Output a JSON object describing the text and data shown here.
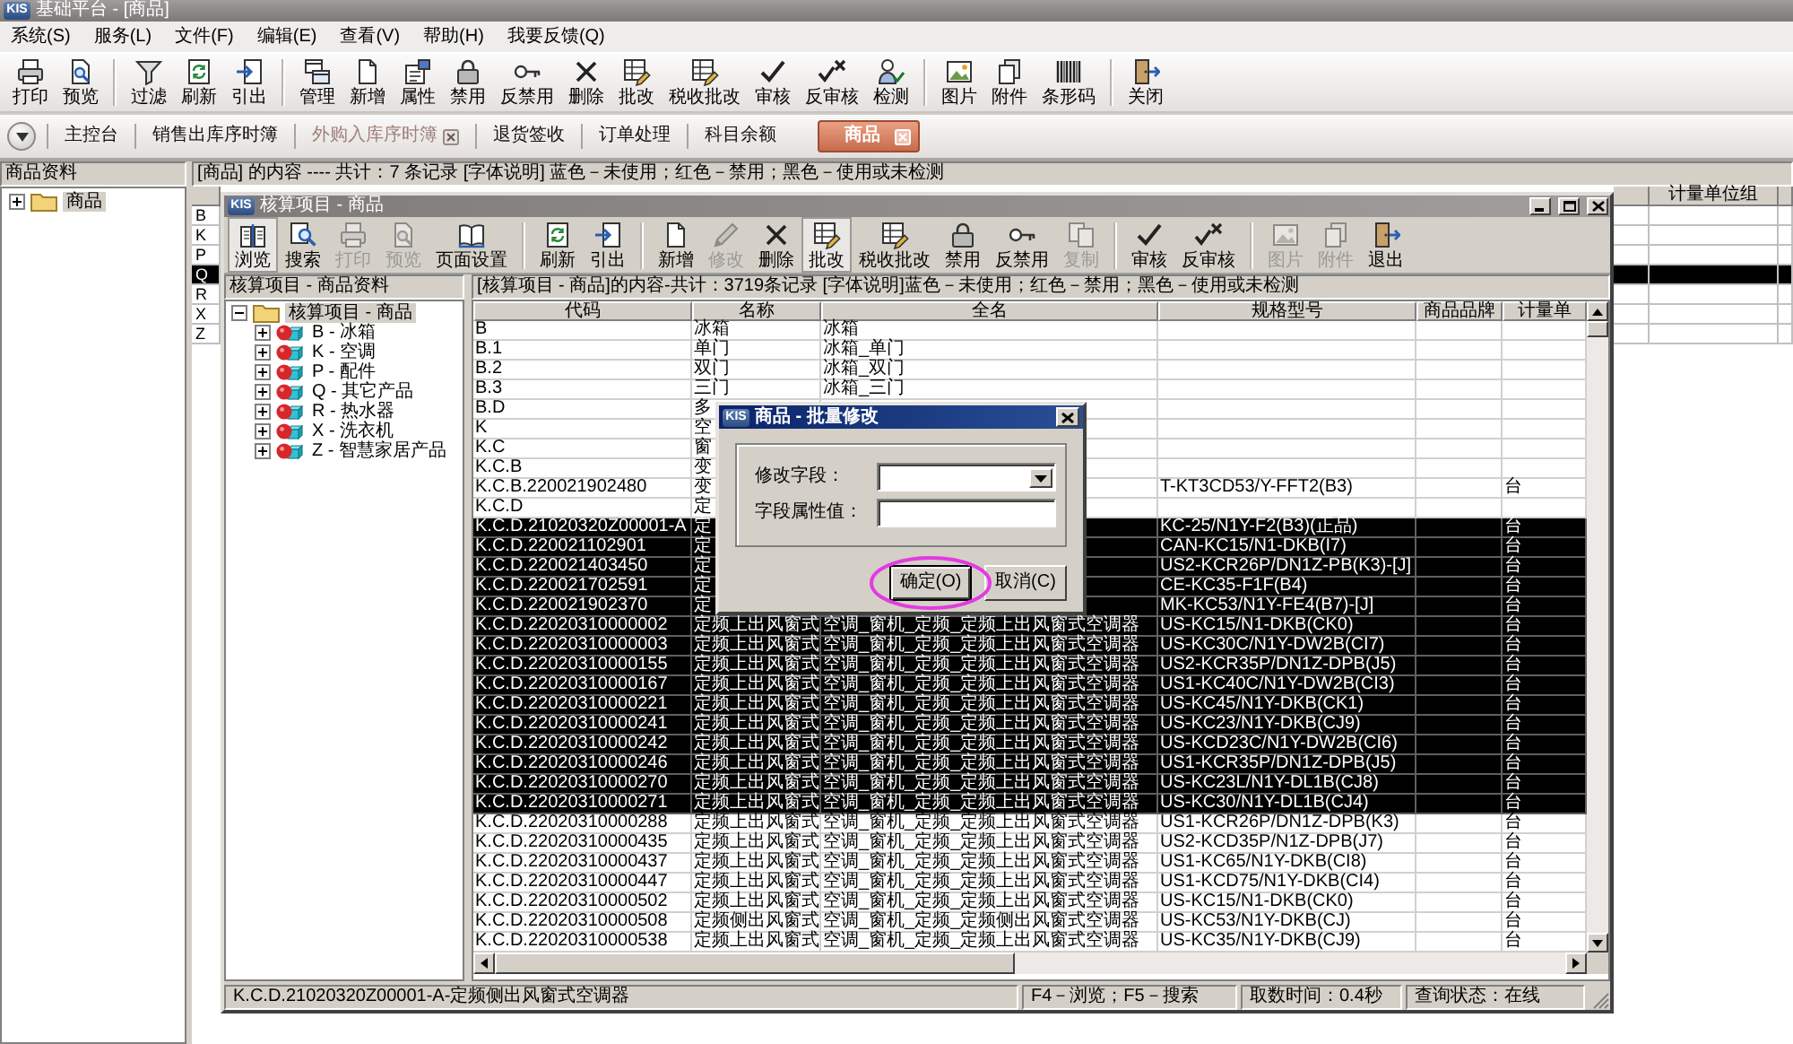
{
  "window": {
    "logo": "KIS",
    "title": "基础平台 - [商品]"
  },
  "menu": [
    "系统(S)",
    "服务(L)",
    "文件(F)",
    "编辑(E)",
    "查看(V)",
    "帮助(H)",
    "我要反馈(Q)"
  ],
  "toolbar": [
    [
      {
        "label": "打印"
      },
      {
        "label": "预览"
      }
    ],
    [
      {
        "label": "过滤"
      },
      {
        "label": "刷新"
      },
      {
        "label": "引出"
      }
    ],
    [
      {
        "label": "管理"
      },
      {
        "label": "新增"
      },
      {
        "label": "属性"
      },
      {
        "label": "禁用"
      },
      {
        "label": "反禁用"
      },
      {
        "label": "删除"
      },
      {
        "label": "批改"
      },
      {
        "label": "税收批改"
      },
      {
        "label": "审核"
      },
      {
        "label": "反审核"
      },
      {
        "label": "检测"
      }
    ],
    [
      {
        "label": "图片"
      },
      {
        "label": "附件"
      },
      {
        "label": "条形码"
      }
    ],
    [
      {
        "label": "关闭"
      }
    ]
  ],
  "tabs": [
    {
      "label": "主控台",
      "selected": false,
      "hovered": false
    },
    {
      "label": "销售出库序时簿",
      "selected": false,
      "hovered": false
    },
    {
      "label": "外购入库序时簿",
      "selected": false,
      "hovered": true
    },
    {
      "label": "退货签收",
      "selected": false,
      "hovered": false
    },
    {
      "label": "订单处理",
      "selected": false,
      "hovered": false
    },
    {
      "label": "科目余额",
      "selected": false,
      "hovered": false
    },
    {
      "label": "商品",
      "selected": true,
      "hovered": false
    }
  ],
  "left_panel": {
    "title": "商品资料",
    "tree": [
      {
        "label": "商品",
        "expanded": false,
        "selected": true
      }
    ]
  },
  "content_info": "[商品] 的内容 ---- 共计：7 条记录 [字体说明] 蓝色－未使用；红色－禁用；黑色－使用或未检测",
  "background_grid": {
    "columns": [
      "计量单位组"
    ],
    "rows": [
      {
        "code": "B",
        "selected": false
      },
      {
        "code": "K",
        "selected": false
      },
      {
        "code": "P",
        "selected": false
      },
      {
        "code": "Q",
        "selected": true
      },
      {
        "code": "R",
        "selected": false
      },
      {
        "code": "X",
        "selected": false
      },
      {
        "code": "Z",
        "selected": false
      }
    ]
  },
  "child_window": {
    "logo": "KIS",
    "title": "核算项目 - 商品",
    "toolbar": [
      [
        {
          "label": "浏览",
          "disabled": false,
          "pressed": true
        },
        {
          "label": "搜索",
          "disabled": false,
          "pressed": false
        },
        {
          "label": "打印",
          "disabled": true,
          "pressed": false
        },
        {
          "label": "预览",
          "disabled": true,
          "pressed": false
        },
        {
          "label": "页面设置",
          "disabled": false,
          "pressed": false
        }
      ],
      [
        {
          "label": "刷新",
          "disabled": false,
          "pressed": false
        },
        {
          "label": "引出",
          "disabled": false,
          "pressed": false
        }
      ],
      [
        {
          "label": "新增",
          "disabled": false,
          "pressed": false
        },
        {
          "label": "修改",
          "disabled": true,
          "pressed": false
        },
        {
          "label": "删除",
          "disabled": false,
          "pressed": false
        },
        {
          "label": "批改",
          "disabled": false,
          "pressed": true
        },
        {
          "label": "税收批改",
          "disabled": false,
          "pressed": false
        },
        {
          "label": "禁用",
          "disabled": false,
          "pressed": false
        },
        {
          "label": "反禁用",
          "disabled": false,
          "pressed": false
        },
        {
          "label": "复制",
          "disabled": true,
          "pressed": false
        }
      ],
      [
        {
          "label": "审核",
          "disabled": false,
          "pressed": false
        },
        {
          "label": "反审核",
          "disabled": false,
          "pressed": false
        }
      ],
      [
        {
          "label": "图片",
          "disabled": true,
          "pressed": false
        },
        {
          "label": "附件",
          "disabled": true,
          "pressed": false
        },
        {
          "label": "退出",
          "disabled": false,
          "pressed": false
        }
      ]
    ],
    "tree_title": "核算项目 - 商品资料",
    "info": "[核算项目 - 商品]的内容-共计：3719条记录 [字体说明]蓝色－未使用；红色－禁用；黑色－使用或未检测",
    "tree": [
      {
        "label": "核算项目 - 商品",
        "expanded": true,
        "selected": true,
        "children": [
          {
            "label": "B - 冰箱",
            "expanded": false,
            "selected": false
          },
          {
            "label": "K - 空调",
            "expanded": false,
            "selected": false
          },
          {
            "label": "P - 配件",
            "expanded": false,
            "selected": false
          },
          {
            "label": "Q - 其它产品",
            "expanded": false,
            "selected": false
          },
          {
            "label": "R - 热水器",
            "expanded": false,
            "selected": false
          },
          {
            "label": "X - 洗衣机",
            "expanded": false,
            "selected": false
          },
          {
            "label": "Z - 智慧家居产品",
            "expanded": false,
            "selected": false
          }
        ]
      }
    ],
    "table": {
      "columns": [
        "代码",
        "名称",
        "全名",
        "规格型号",
        "商品品牌",
        "计量单"
      ],
      "rows": [
        {
          "code": "B",
          "name": "冰箱",
          "full_name": "冰箱",
          "selected": false
        },
        {
          "code": "B.1",
          "name": "单门",
          "full_name": "冰箱_单门",
          "selected": false
        },
        {
          "code": "B.2",
          "name": "双门",
          "full_name": "冰箱_双门",
          "selected": false
        },
        {
          "code": "B.3",
          "name": "三门",
          "full_name": "冰箱_三门",
          "selected": false
        },
        {
          "code": "B.D",
          "name": "多",
          "selected": false
        },
        {
          "code": "K",
          "name": "空",
          "selected": false
        },
        {
          "code": "K.C",
          "name": "窗",
          "selected": false
        },
        {
          "code": "K.C.B",
          "name": "变",
          "selected": false
        },
        {
          "code": "K.C.B.220021902480",
          "name": "变",
          "spec": "T-KT3CD53/Y-FFT2(B3)",
          "unit": "台",
          "selected": false
        },
        {
          "code": "K.C.D",
          "name": "定",
          "selected": false
        },
        {
          "code": "K.C.D.21020320Z00001-A",
          "name": "定",
          "spec": "KC-25/N1Y-F2(B3)(正品)",
          "unit": "台",
          "selected": true
        },
        {
          "code": "K.C.D.220021102901",
          "name": "定",
          "spec": "CAN-KC15/N1-DKB(I7)",
          "unit": "台",
          "selected": true
        },
        {
          "code": "K.C.D.220021403450",
          "name": "定",
          "spec": "US2-KCR26P/DN1Z-PB(K3)-[J]",
          "unit": "台",
          "selected": true
        },
        {
          "code": "K.C.D.220021702591",
          "name": "定",
          "spec": "CE-KC35-F1F(B4)",
          "unit": "台",
          "selected": true
        },
        {
          "code": "K.C.D.220021902370",
          "name": "定",
          "spec": "MK-KC53/N1Y-FE4(B7)-[J]",
          "unit": "台",
          "selected": true
        },
        {
          "code": "K.C.D.22020310000002",
          "name": "定频上出风窗式",
          "full_name": "空调_窗机_定频_定频上出风窗式空调器",
          "spec": "US-KC15/N1-DKB(CK0)",
          "unit": "台",
          "selected": true
        },
        {
          "code": "K.C.D.22020310000003",
          "name": "定频上出风窗式",
          "full_name": "空调_窗机_定频_定频上出风窗式空调器",
          "spec": "US-KC30C/N1Y-DW2B(CI7)",
          "unit": "台",
          "selected": true
        },
        {
          "code": "K.C.D.22020310000155",
          "name": "定频上出风窗式",
          "full_name": "空调_窗机_定频_定频上出风窗式空调器",
          "spec": "US2-KCR35P/DN1Z-DPB(J5)",
          "unit": "台",
          "selected": true
        },
        {
          "code": "K.C.D.22020310000167",
          "name": "定频上出风窗式",
          "full_name": "空调_窗机_定频_定频上出风窗式空调器",
          "spec": "US1-KC40C/N1Y-DW2B(CI3)",
          "unit": "台",
          "selected": true
        },
        {
          "code": "K.C.D.22020310000221",
          "name": "定频上出风窗式",
          "full_name": "空调_窗机_定频_定频上出风窗式空调器",
          "spec": "US-KC45/N1Y-DKB(CK1)",
          "unit": "台",
          "selected": true
        },
        {
          "code": "K.C.D.22020310000241",
          "name": "定频上出风窗式",
          "full_name": "空调_窗机_定频_定频上出风窗式空调器",
          "spec": "US-KC23/N1Y-DKB(CJ9)",
          "unit": "台",
          "selected": true
        },
        {
          "code": "K.C.D.22020310000242",
          "name": "定频上出风窗式",
          "full_name": "空调_窗机_定频_定频上出风窗式空调器",
          "spec": "US-KCD23C/N1Y-DW2B(CI6)",
          "unit": "台",
          "selected": true
        },
        {
          "code": "K.C.D.22020310000246",
          "name": "定频上出风窗式",
          "full_name": "空调_窗机_定频_定频上出风窗式空调器",
          "spec": "US1-KCR35P/DN1Z-DPB(J5)",
          "unit": "台",
          "selected": true
        },
        {
          "code": "K.C.D.22020310000270",
          "name": "定频上出风窗式",
          "full_name": "空调_窗机_定频_定频上出风窗式空调器",
          "spec": "US-KC23L/N1Y-DL1B(CJ8)",
          "unit": "台",
          "selected": true
        },
        {
          "code": "K.C.D.22020310000271",
          "name": "定频上出风窗式",
          "full_name": "空调_窗机_定频_定频上出风窗式空调器",
          "spec": "US-KC30/N1Y-DL1B(CJ4)",
          "unit": "台",
          "selected": true
        },
        {
          "code": "K.C.D.22020310000288",
          "name": "定频上出风窗式",
          "full_name": "空调_窗机_定频_定频上出风窗式空调器",
          "spec": "US1-KCR26P/DN1Z-DPB(K3)",
          "unit": "台",
          "selected": false
        },
        {
          "code": "K.C.D.22020310000435",
          "name": "定频上出风窗式",
          "full_name": "空调_窗机_定频_定频上出风窗式空调器",
          "spec": "US2-KCD35P/N1Z-DPB(J7)",
          "unit": "台",
          "selected": false
        },
        {
          "code": "K.C.D.22020310000437",
          "name": "定频上出风窗式",
          "full_name": "空调_窗机_定频_定频上出风窗式空调器",
          "spec": "US1-KC65/N1Y-DKB(CI8)",
          "unit": "台",
          "selected": false
        },
        {
          "code": "K.C.D.22020310000447",
          "name": "定频上出风窗式",
          "full_name": "空调_窗机_定频_定频上出风窗式空调器",
          "spec": "US1-KCD75/N1Y-DKB(CI4)",
          "unit": "台",
          "selected": false
        },
        {
          "code": "K.C.D.22020310000502",
          "name": "定频上出风窗式",
          "full_name": "空调_窗机_定频_定频上出风窗式空调器",
          "spec": "US-KC15/N1-DKB(CK0)",
          "unit": "台",
          "selected": false
        },
        {
          "code": "K.C.D.22020310000508",
          "name": "定频侧出风窗式",
          "full_name": "空调_窗机_定频_定频侧出风窗式空调器",
          "spec": "US-KC53/N1Y-DKB(CJ)",
          "unit": "台",
          "selected": false
        },
        {
          "code": "K.C.D.22020310000538",
          "name": "定频上出风窗式",
          "full_name": "空调_窗机_定频_定频上出风窗式空调器",
          "spec": "US-KC35/N1Y-DKB(CJ9)",
          "unit": "台",
          "selected": false
        }
      ]
    },
    "status_bar": [
      "K.C.D.21020320Z00001-A-定频侧出风窗式空调器",
      "F4－浏览；F5－搜索",
      "取数时间：0.4秒",
      "查询状态：在线"
    ]
  },
  "dialog": {
    "logo": "KIS",
    "title": "商品 - 批量修改",
    "fields": [
      {
        "kind": "dropdown",
        "label": "修改字段："
      },
      {
        "kind": "text",
        "label": "字段属性值："
      }
    ],
    "buttons": [
      {
        "label": "确定(O)",
        "default": true
      },
      {
        "label": "取消(C)",
        "default": false
      }
    ]
  }
}
